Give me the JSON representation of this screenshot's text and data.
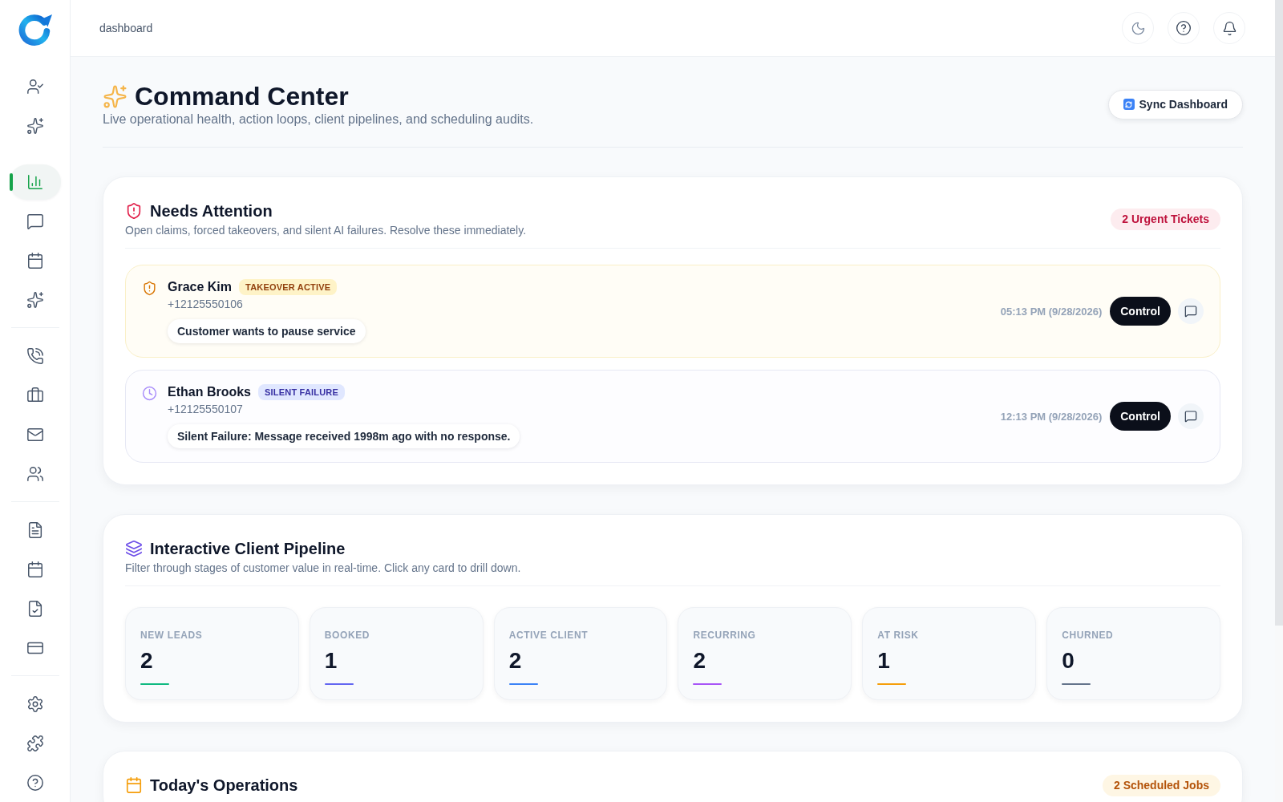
{
  "header": {
    "breadcrumb": "dashboard"
  },
  "sidebar": {
    "groups": [
      {
        "items": [
          {
            "selected": false
          },
          {
            "selected": false
          }
        ]
      },
      {
        "items": [
          {
            "selected": true
          },
          {
            "selected": false
          },
          {
            "selected": false
          },
          {
            "selected": false
          }
        ]
      },
      {
        "items": [
          {
            "selected": false
          },
          {
            "selected": false
          },
          {
            "selected": false
          },
          {
            "selected": false
          }
        ]
      },
      {
        "items": [
          {
            "selected": false
          },
          {
            "selected": false
          },
          {
            "selected": false
          },
          {
            "selected": false
          }
        ]
      },
      {
        "items": [
          {
            "selected": false
          },
          {
            "selected": false
          },
          {
            "selected": false
          }
        ]
      }
    ]
  },
  "page": {
    "title": "Command Center",
    "subtitle": "Live operational health, action loops, client pipelines, and scheduling audits.",
    "sync_button": "Sync Dashboard"
  },
  "needs_attention": {
    "title": "Needs Attention",
    "subtitle": "Open claims, forced takeovers, and silent AI failures. Resolve these immediately.",
    "badge": "2 Urgent Tickets",
    "items": [
      {
        "kind": "takeover",
        "name": "Grace Kim",
        "tag": "TAKEOVER ACTIVE",
        "phone": "+12125550106",
        "reason": "Customer wants to pause service",
        "time": "05:13 PM (9/28/2026)",
        "action": "Control"
      },
      {
        "kind": "silent_failure",
        "name": "Ethan Brooks",
        "tag": "SILENT FAILURE",
        "phone": "+12125550107",
        "reason": "Silent Failure: Message received 1998m ago with no response.",
        "time": "12:13 PM (9/28/2026)",
        "action": "Control"
      }
    ]
  },
  "pipeline": {
    "title": "Interactive Client Pipeline",
    "subtitle": "Filter through stages of customer value in real-time. Click any card to drill down.",
    "stages": [
      {
        "label": "NEW LEADS",
        "count": "2",
        "color": "#10b981"
      },
      {
        "label": "BOOKED",
        "count": "1",
        "color": "#6366f1"
      },
      {
        "label": "ACTIVE CLIENT",
        "count": "2",
        "color": "#3b82f6"
      },
      {
        "label": "RECURRING",
        "count": "2",
        "color": "#a855f7"
      },
      {
        "label": "AT RISK",
        "count": "1",
        "color": "#f59e0b"
      },
      {
        "label": "CHURNED",
        "count": "0",
        "color": "#64748b"
      }
    ]
  },
  "operations": {
    "title": "Today's Operations",
    "badge": "2 Scheduled Jobs"
  }
}
